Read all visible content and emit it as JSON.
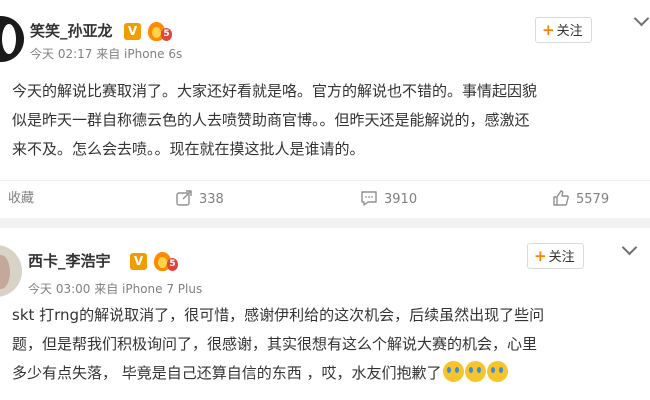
{
  "post1": {
    "username": "笑笑_孙亚龙",
    "verified_badge": "V",
    "level": "5",
    "meta": "今天 02:17 来自 iPhone 6s",
    "follow_label": "关注",
    "content_lines": [
      "今天的解说比赛取消了。大家还好看就是咯。官方的解说也不错的。事情起因貌",
      "似是昨天一群自称德云色的人去喷赞助商官博。。但昨天还是能解说的，感激还",
      "来不及。怎么会去喷。。现在就在摸这批人是谁请的。"
    ],
    "actions": {
      "favorite_label": "收藏",
      "repost_count": "338",
      "comment_count": "3910",
      "like_count": "5579"
    }
  },
  "post2": {
    "username": "西卡_李浩宇",
    "verified_badge": "V",
    "level": "5",
    "meta": "今天 03:00 来自 iPhone 7 Plus",
    "follow_label": "关注",
    "content_lines": [
      "skt 打rng的解说取消了，很可惜，感谢伊利给的这次机会，后续虽然出现了些问",
      "题，但是帮我们积极询问了，很感谢，其实很想有这么个解说大赛的机会，心里",
      "多少有点失落， 毕竟是自己还算自信的东西 ，哎，水友们抱歉了"
    ],
    "emojis": [
      "crying-emoji",
      "crying-emoji",
      "crying-emoji"
    ]
  },
  "colors": {
    "accent": "#ff8200",
    "verified": "#f39c00",
    "muted_text": "#808080"
  }
}
